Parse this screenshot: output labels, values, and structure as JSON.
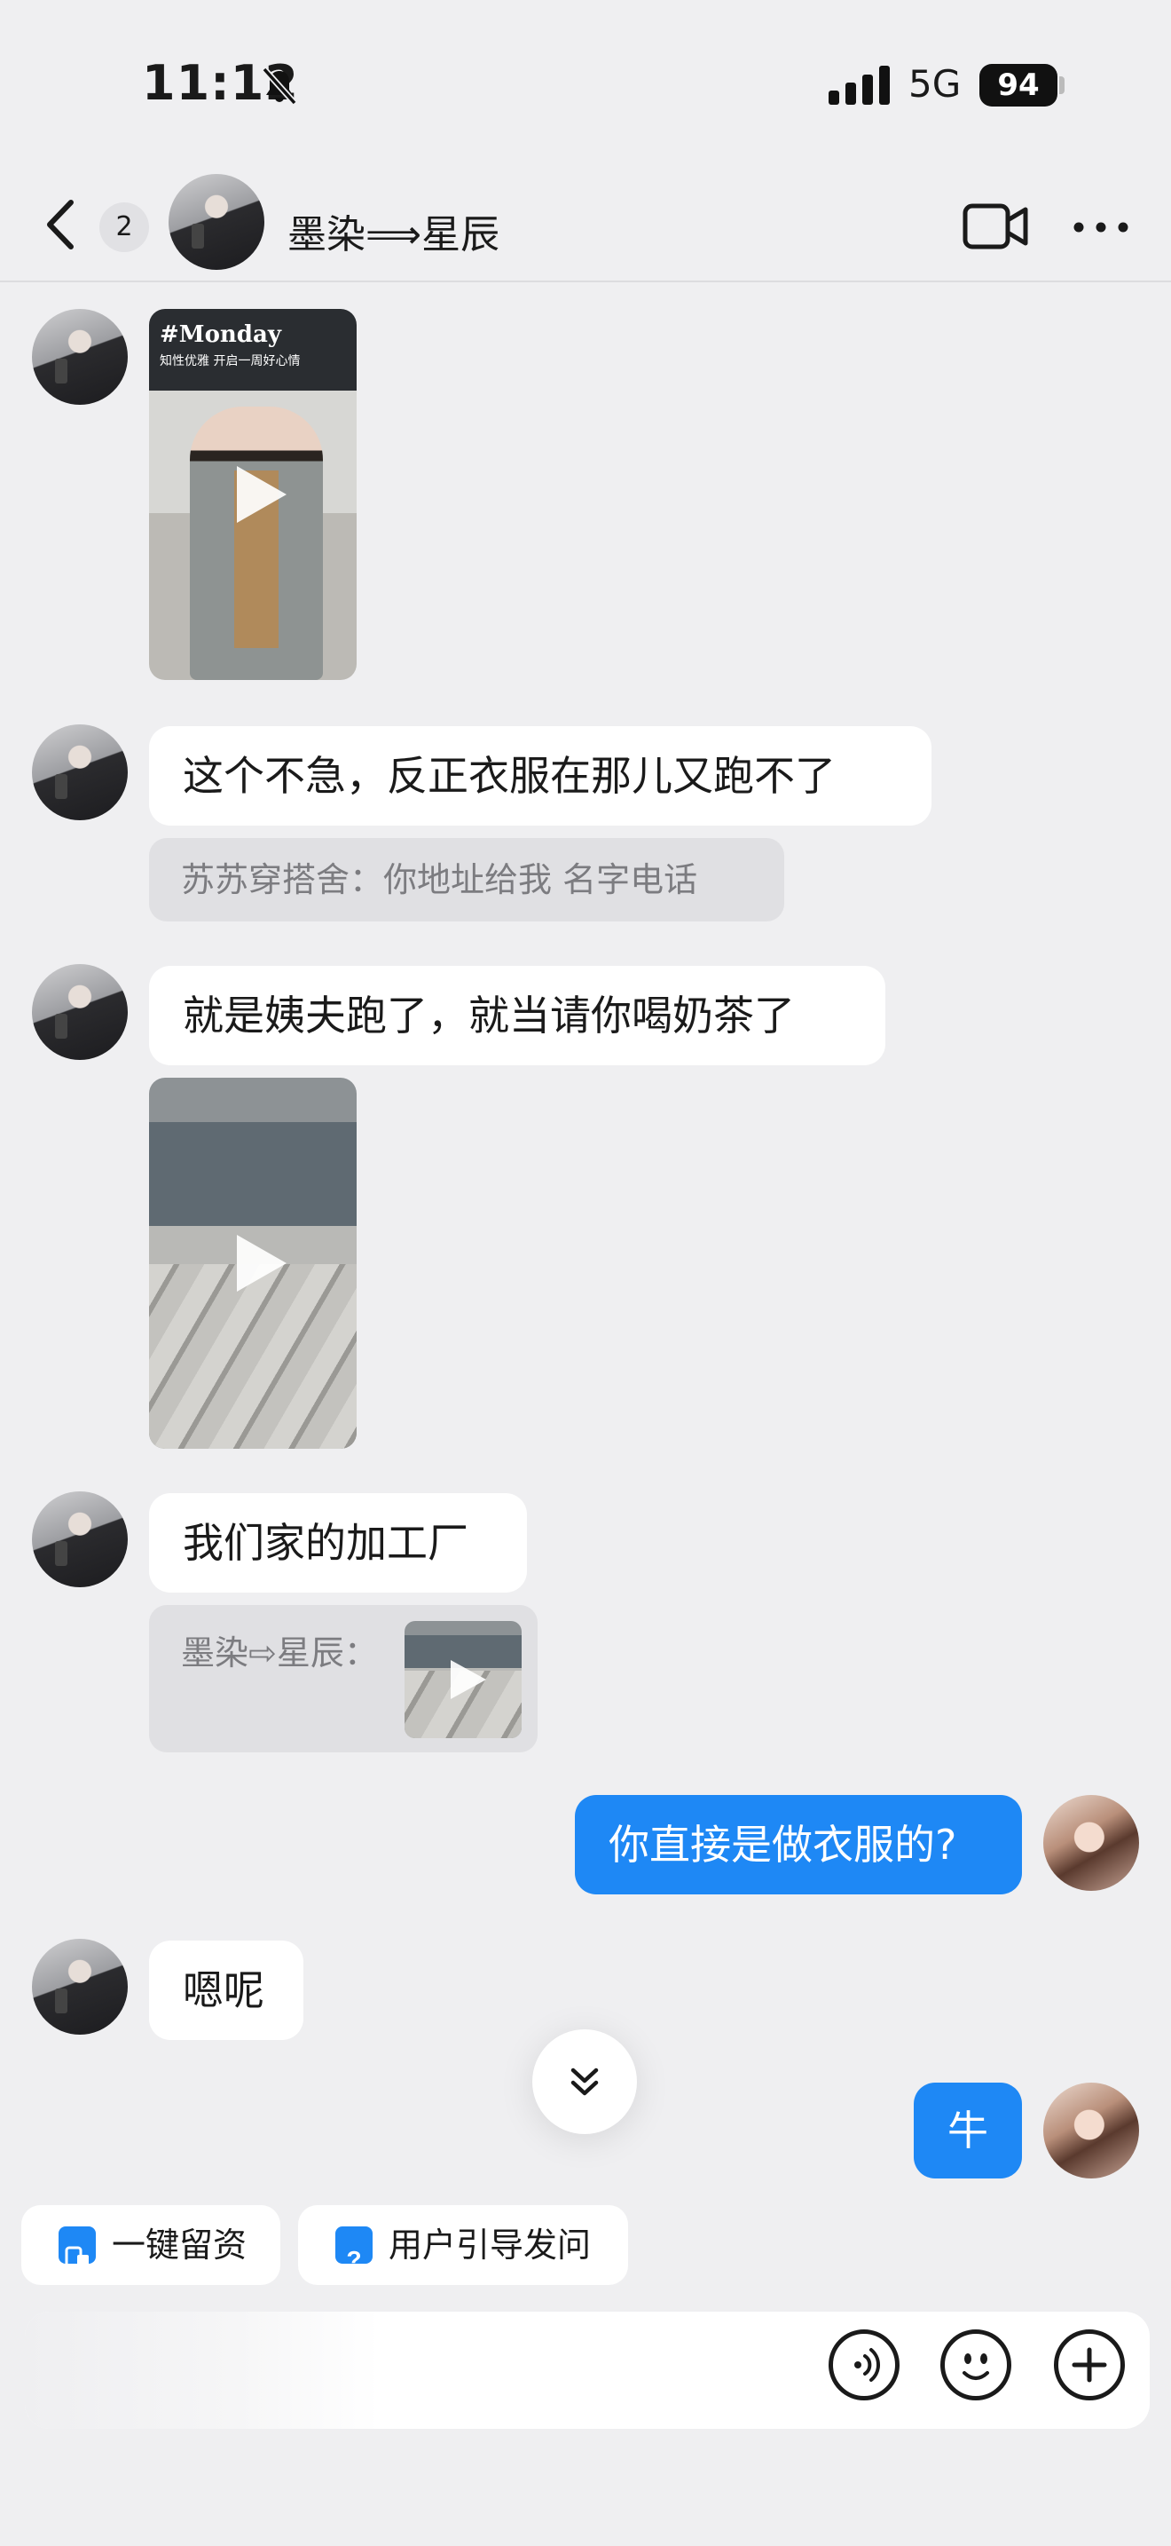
{
  "status_bar": {
    "time": "11:12",
    "network": "5G",
    "battery": "94",
    "icons": [
      "bell-slash-icon",
      "signal-icon"
    ]
  },
  "header": {
    "back_icon": "chevron-left-icon",
    "unread_count": "2",
    "title": "墨染⟹星辰",
    "video_icon": "video-camera-icon",
    "more_icon": "ellipsis-icon"
  },
  "messages": {
    "video1": {
      "caption_title": "#Monday",
      "caption_sub": "知性优雅 开启一周好心情"
    },
    "msg1": "这个不急，反正衣服在那儿又跑不了",
    "quote1": "苏苏穿搭舍：你地址给我 名字电话",
    "msg2": "就是姨夫跑了，就当请你喝奶茶了",
    "msg3": "我们家的加工厂",
    "quote2_sender": "墨染⇨星辰：",
    "msg4_out": "你直接是做衣服的?",
    "msg5": "嗯呢",
    "msg6_out": "牛"
  },
  "quick_replies": {
    "chip1": "一键留资",
    "chip2": "用户引导发问"
  },
  "input_bar": {
    "icons": [
      "voice-icon",
      "emoji-icon",
      "plus-icon"
    ]
  },
  "colors": {
    "accent": "#1e88f5",
    "background": "#efeff1",
    "bubble_in": "#ffffff"
  }
}
